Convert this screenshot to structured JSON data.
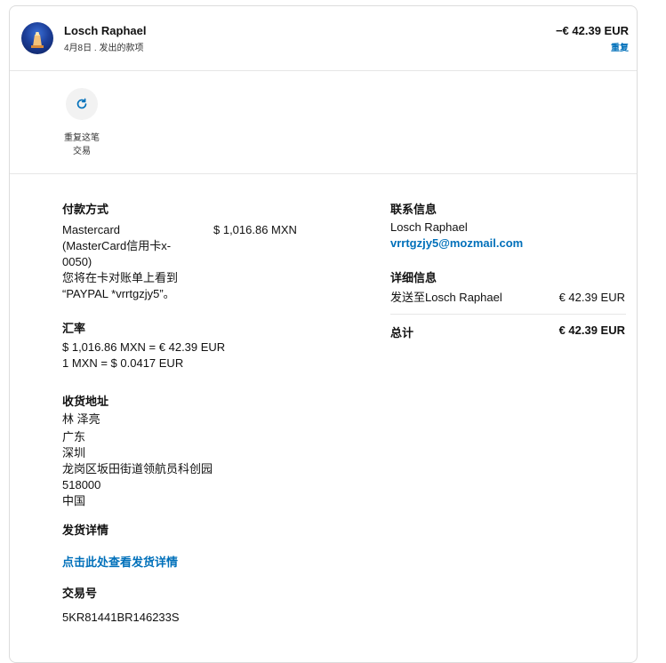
{
  "header": {
    "name": "Losch Raphael",
    "date_desc": "4月8日 . 发出的款项",
    "amount": "−€ 42.39 EUR",
    "repeat_link": "重复"
  },
  "action": {
    "repeat_label_line1": "重复这笔",
    "repeat_label_line2": "交易"
  },
  "payment": {
    "title": "付款方式",
    "card_line1": "Mastercard",
    "card_line2": "(MasterCard信用卡x-",
    "card_line3": "0050)",
    "amount": "$ 1,016.86 MXN",
    "note_line1": "您将在卡对账单上看到",
    "note_line2": "“PAYPAL *vrrtgzjy5”。"
  },
  "exchange": {
    "title": "汇率",
    "line1": "$ 1,016.86 MXN = € 42.39 EUR",
    "line2": "1 MXN = $ 0.0417 EUR"
  },
  "shipping_address": {
    "title": "收货地址",
    "lines": [
      "林 泽亮",
      "广东",
      "深圳",
      "龙岗区坂田街道领航员科创园",
      "518000",
      "中国"
    ]
  },
  "shipping_details": {
    "title": "发货详情",
    "link": "点击此处查看发货详情"
  },
  "transaction": {
    "title": "交易号",
    "id": "5KR81441BR146233S"
  },
  "contact": {
    "title": "联系信息",
    "name": "Losch Raphael",
    "email": "vrrtgzjy5@mozmail.com"
  },
  "details": {
    "title": "详细信息",
    "sent_to_label": "发送至Losch Raphael",
    "sent_to_amount": "€ 42.39 EUR",
    "total_label": "总计",
    "total_amount": "€ 42.39 EUR"
  },
  "colors": {
    "link": "#0070ba",
    "text": "#111111"
  }
}
